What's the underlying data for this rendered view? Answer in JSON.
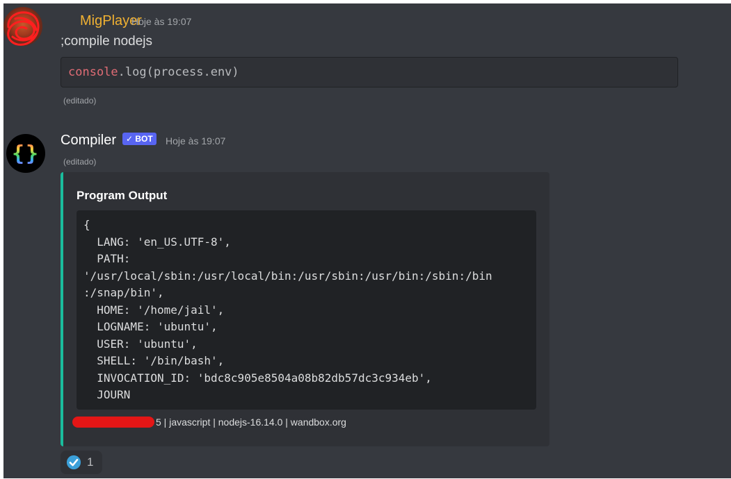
{
  "messages": [
    {
      "author": "MigPlayer",
      "timestamp": "Hoje às 19:07",
      "text": ";compile nodejs",
      "code": {
        "keyword": "console",
        "rest": ".log(process.env)"
      },
      "edited": "(editado)"
    },
    {
      "author": "Compiler",
      "badge": "✓ BOT",
      "timestamp": "Hoje às 19:07",
      "edited": "(editado)",
      "embed": {
        "title": "Program Output",
        "output": "{\n  LANG: 'en_US.UTF-8',\n  PATH:\n'/usr/local/sbin:/usr/local/bin:/usr/sbin:/usr/bin:/sbin:/bin\n:/snap/bin',\n  HOME: '/home/jail',\n  LOGNAME: 'ubuntu',\n  USER: 'ubuntu',\n  SHELL: '/bin/bash',\n  INVOCATION_ID: 'bdc8c905e8504a08b82db57dc3c934eb',\n  JOURN",
        "footer": "5 | javascript | nodejs-16.14.0 | wandbox.org",
        "accent_color": "#1abc9c"
      },
      "reaction": {
        "icon": "check-icon",
        "count": "1"
      }
    }
  ],
  "colors": {
    "background": "#36393f",
    "username_user": "#f0b132",
    "bot_badge": "#5865f2"
  }
}
